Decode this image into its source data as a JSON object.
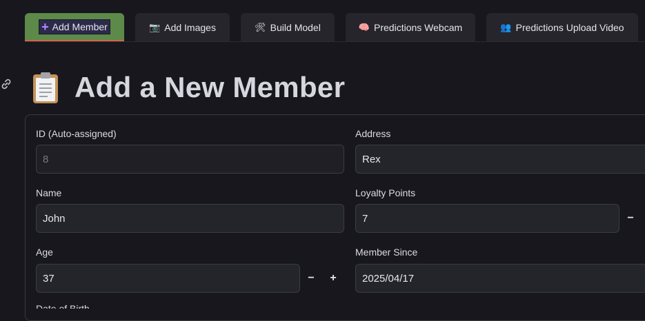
{
  "tabs": [
    {
      "label": "Add Member",
      "icon": "plus-icon",
      "active": true
    },
    {
      "label": "Add Images",
      "icon": "camera-icon",
      "active": false
    },
    {
      "label": "Build Model",
      "icon": "tools-icon",
      "active": false
    },
    {
      "label": "Predictions Webcam",
      "icon": "brain-icon",
      "active": false
    },
    {
      "label": "Predictions Upload Video",
      "icon": "people-icon",
      "active": false
    }
  ],
  "page": {
    "title": "Add a New Member",
    "title_icon": "clipboard-icon"
  },
  "form": {
    "id": {
      "label": "ID (Auto-assigned)",
      "value": "8"
    },
    "name": {
      "label": "Name",
      "value": "John"
    },
    "age": {
      "label": "Age",
      "value": "37",
      "minus": "−",
      "plus": "+"
    },
    "address": {
      "label": "Address",
      "value": "Rex"
    },
    "loyalty": {
      "label": "Loyalty Points",
      "value": "7",
      "minus": "−"
    },
    "member_since": {
      "label": "Member Since",
      "value": "2025/04/17"
    },
    "next_label_partial": "Date of Birth"
  },
  "colors": {
    "background": "#17171d",
    "active_tab": "#5d8a48",
    "active_underline": "#d0654e",
    "field_bg": "#24242b"
  }
}
